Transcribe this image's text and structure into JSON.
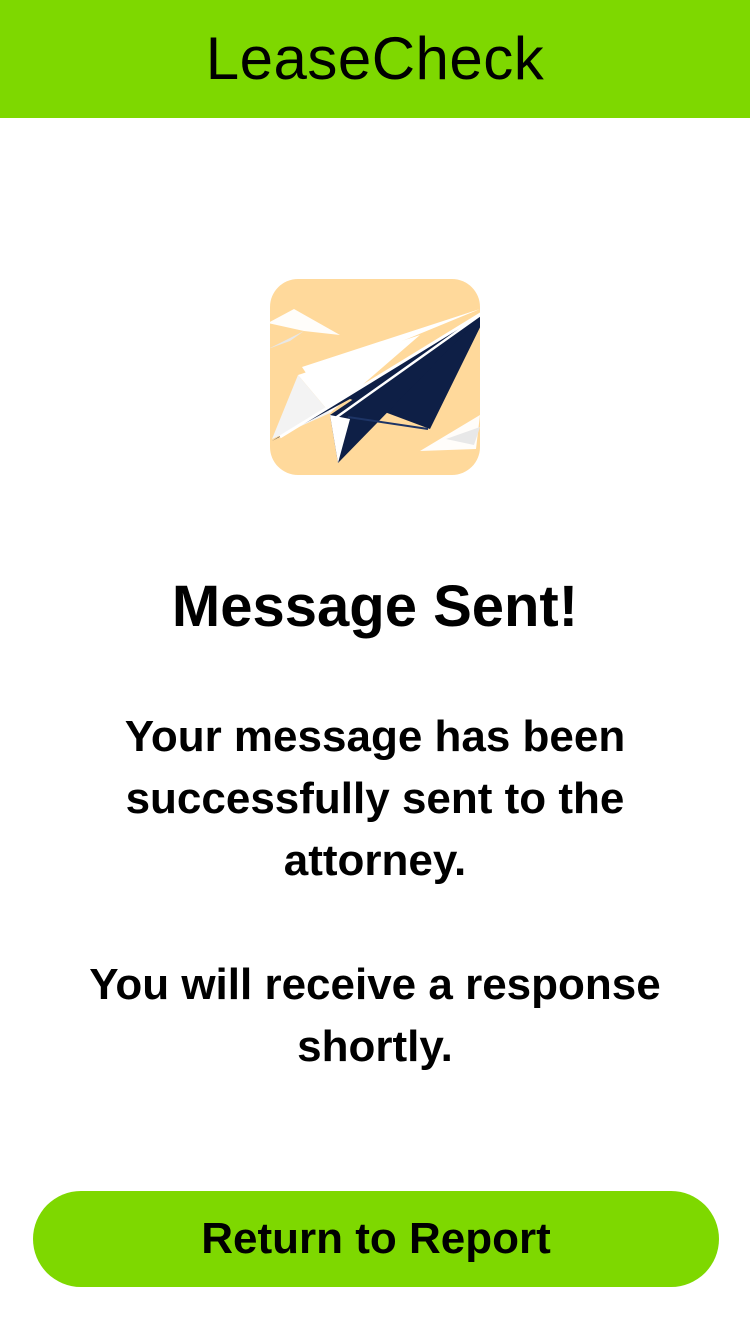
{
  "header": {
    "title": "LeaseCheck"
  },
  "confirmation": {
    "icon": "paper-plane-icon",
    "headline": "Message Sent!",
    "message": "Your message has been successfully sent to the attorney.",
    "followup": "You will receive a response shortly."
  },
  "actions": {
    "return_label": "Return to Report"
  },
  "colors": {
    "accent": "#7ed800",
    "icon_background": "#ffd99b",
    "plane": "#0e1f46"
  }
}
